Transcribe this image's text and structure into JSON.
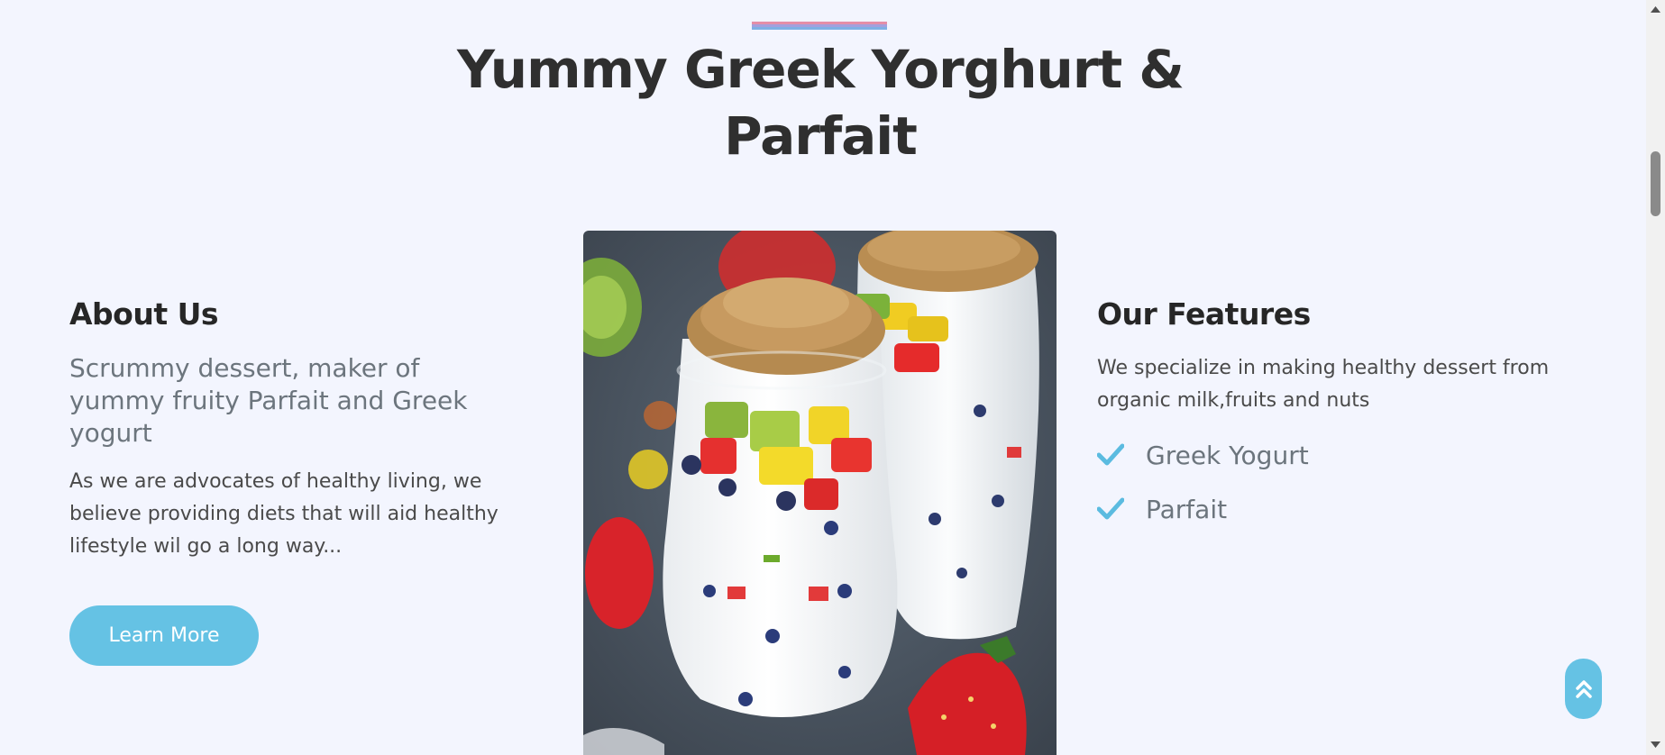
{
  "hero": {
    "title_line1": "Yummy Greek Yorghurt &",
    "title_line2": "Parfait"
  },
  "about": {
    "heading": "About Us",
    "subtitle": "Scrummy dessert, maker of yummy fruity Parfait and Greek yogurt",
    "body": "As we are advocates of healthy living, we believe providing diets that will aid healthy lifestyle wil go a long way...",
    "button_label": "Learn More"
  },
  "photo": {
    "subject": "parfait-glasses-photo"
  },
  "features": {
    "heading": "Our Features",
    "body": "We specialize in making healthy dessert from organic milk,fruits and nuts",
    "items": [
      {
        "label": "Greek Yogurt",
        "icon": "check-icon"
      },
      {
        "label": "Parfait",
        "icon": "check-icon"
      }
    ]
  },
  "scroll_top": {
    "icon": "double-chevron-up-icon"
  },
  "colors": {
    "background": "#f3f5fe",
    "accent": "#65c2e4",
    "heading": "#2f2f2f",
    "muted": "#6c757d"
  }
}
